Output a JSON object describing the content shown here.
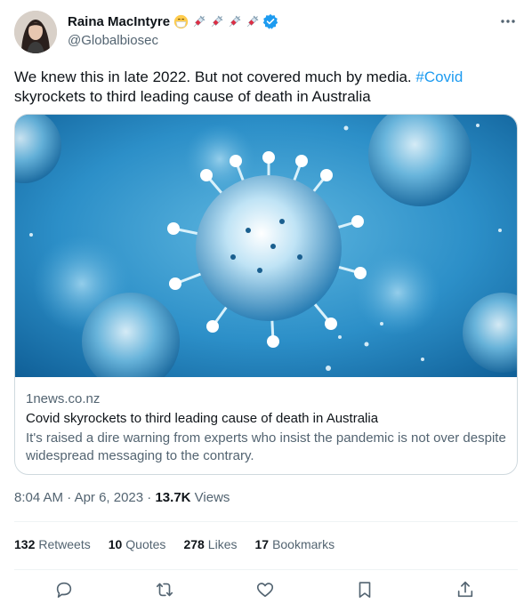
{
  "author": {
    "display_name": "Raina MacIntyre",
    "handle": "@Globalbiosec",
    "emojis": [
      "mask-emoji",
      "syringe-emoji",
      "syringe-emoji",
      "syringe-emoji",
      "syringe-emoji"
    ]
  },
  "tweet": {
    "text_prefix": "We knew this in late 2022. But not covered much by media. ",
    "hashtag": "#Covid",
    "text_suffix": " skyrockets to third leading cause of death in Australia"
  },
  "card": {
    "domain": "1news.co.nz",
    "title": "Covid skyrockets to third leading cause of death in Australia",
    "description": "It's raised a dire warning from experts who insist the pandemic is not over despite widespread messaging to the contrary."
  },
  "meta": {
    "time": "8:04 AM",
    "separator_1": " · ",
    "date": "Apr 6, 2023",
    "separator_2": " · ",
    "views_count": "13.7K",
    "views_label": " Views"
  },
  "stats": [
    {
      "count": "132",
      "label": "Retweets"
    },
    {
      "count": "10",
      "label": "Quotes"
    },
    {
      "count": "278",
      "label": "Likes"
    },
    {
      "count": "17",
      "label": "Bookmarks"
    }
  ],
  "colors": {
    "accent": "#1d9bf0",
    "text": "#0f1419",
    "secondary": "#536471",
    "border": "#cfd9de"
  }
}
